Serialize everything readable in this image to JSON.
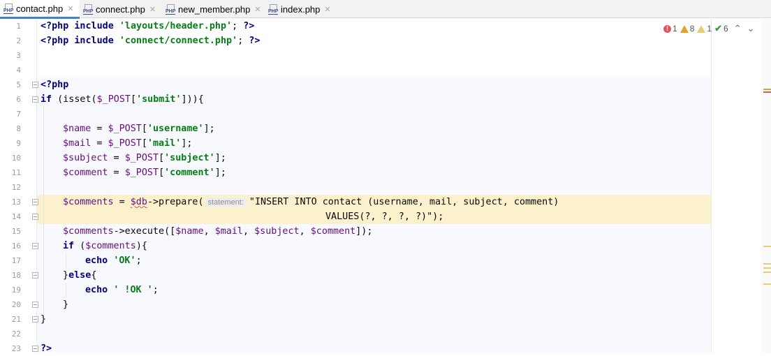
{
  "tabs": [
    {
      "label": "contact.php",
      "active": true
    },
    {
      "label": "connect.php",
      "active": false
    },
    {
      "label": "new_member.php",
      "active": false
    },
    {
      "label": "index.php",
      "active": false
    }
  ],
  "tab_icon_text": "PHP",
  "close_glyph": "✕",
  "inspections": {
    "errors": "1",
    "warnings": "8",
    "weak_warnings": "1",
    "typos": "6",
    "up_arrow": "⌃",
    "down_arrow": "⌄"
  },
  "line_numbers": [
    "1",
    "2",
    "3",
    "4",
    "5",
    "6",
    "7",
    "8",
    "9",
    "10",
    "11",
    "12",
    "13",
    "14",
    "15",
    "16",
    "17",
    "18",
    "19",
    "20",
    "21",
    "22",
    "23"
  ],
  "code": {
    "l1": {
      "open": "<?php",
      "kw": "include",
      "str": "'layouts/header.php'",
      "rest": "; ",
      "close": "?>"
    },
    "l2": {
      "open": "<?php",
      "kw": "include",
      "str": "'connect/connect.php'",
      "rest": "; ",
      "close": "?>"
    },
    "l5": {
      "open": "<?php"
    },
    "l6": {
      "kw": "if",
      "a": " (isset(",
      "var": "$_POST",
      "b": "[",
      "str": "'submit'",
      "c": "])){"
    },
    "l8": {
      "var": "$name",
      "a": " = ",
      "var2": "$_POST",
      "b": "[",
      "str": "'username'",
      "c": "];"
    },
    "l9": {
      "var": "$mail",
      "a": " = ",
      "var2": "$_POST",
      "b": "[",
      "str": "'mail'",
      "c": "];"
    },
    "l10": {
      "var": "$subject",
      "a": " = ",
      "var2": "$_POST",
      "b": "[",
      "str": "'subject'",
      "c": "];"
    },
    "l11": {
      "var": "$comment",
      "a": " = ",
      "var2": "$_POST",
      "b": "[",
      "str": "'comment'",
      "c": "];"
    },
    "l13": {
      "var": "$comments",
      "a": " = ",
      "var2": "$db",
      "b": "->prepare(",
      "hint": "statement:",
      "c": "\"INSERT INTO contact (username, mail, subject, comment)"
    },
    "l14": {
      "a": "VALUES(?, ?, ?, ?)\");"
    },
    "l15": {
      "var": "$comments",
      "a": "->execute([",
      "v1": "$name",
      "s1": ", ",
      "v2": "$mail",
      "s2": ", ",
      "v3": "$subject",
      "s3": ", ",
      "v4": "$comment",
      "c": "]);"
    },
    "l16": {
      "kw": "if",
      "a": " (",
      "var": "$comments",
      "b": "){"
    },
    "l17": {
      "kw": "echo",
      "str": "'OK'",
      "c": ";"
    },
    "l18": {
      "a": "}",
      "kw": "else",
      "b": "{"
    },
    "l19": {
      "kw": "echo",
      "str": "' !OK '",
      "c": ";"
    },
    "l20": {
      "a": "}"
    },
    "l21": {
      "a": "}"
    },
    "l23": {
      "close": "?>"
    }
  },
  "colors": {
    "keyword": "#000080",
    "string": "#067d17",
    "variable": "#660e7a",
    "current_line": "#fbf1cd",
    "php_block_bg": "#f7f9fe",
    "tab_active_underline": "#4083c9"
  }
}
